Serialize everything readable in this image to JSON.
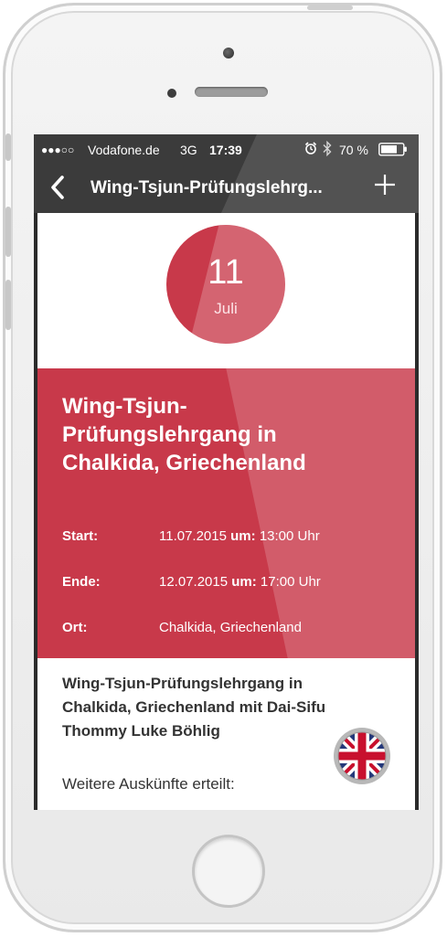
{
  "status": {
    "signal": "●●●○○",
    "carrier": "Vodafone.de",
    "network": "3G",
    "time": "17:39",
    "battery": "70 %"
  },
  "nav": {
    "title": "Wing-Tsjun-Prüfungslehrg..."
  },
  "date": {
    "day": "11",
    "month": "Juli"
  },
  "event": {
    "title": "Wing-Tsjun-Prüfungslehrgang in Chalkida, Griechenland",
    "start_label": "Start:",
    "start_date": "11.07.2015",
    "start_um": "um:",
    "start_time": "13:00 Uhr",
    "end_label": "Ende:",
    "end_date": "12.07.2015",
    "end_um": "um:",
    "end_time": "17:00 Uhr",
    "place_label": "Ort:",
    "place": "Chalkida, Griechenland"
  },
  "description": {
    "headline": "Wing-Tsjun-Prüfungslehrgang in Chalkida, Griechenland mit Dai-Sifu Thommy Luke Böhlig",
    "more": "Weitere Auskünfte erteilt:"
  },
  "colors": {
    "accent": "#c8394a",
    "bar": "#3b3b3b"
  },
  "icons": {
    "back": "chevron-left-icon",
    "add": "plus-icon",
    "alarm": "alarm-icon",
    "bluetooth": "bluetooth-icon",
    "battery": "battery-icon",
    "flag": "uk-flag-icon"
  }
}
